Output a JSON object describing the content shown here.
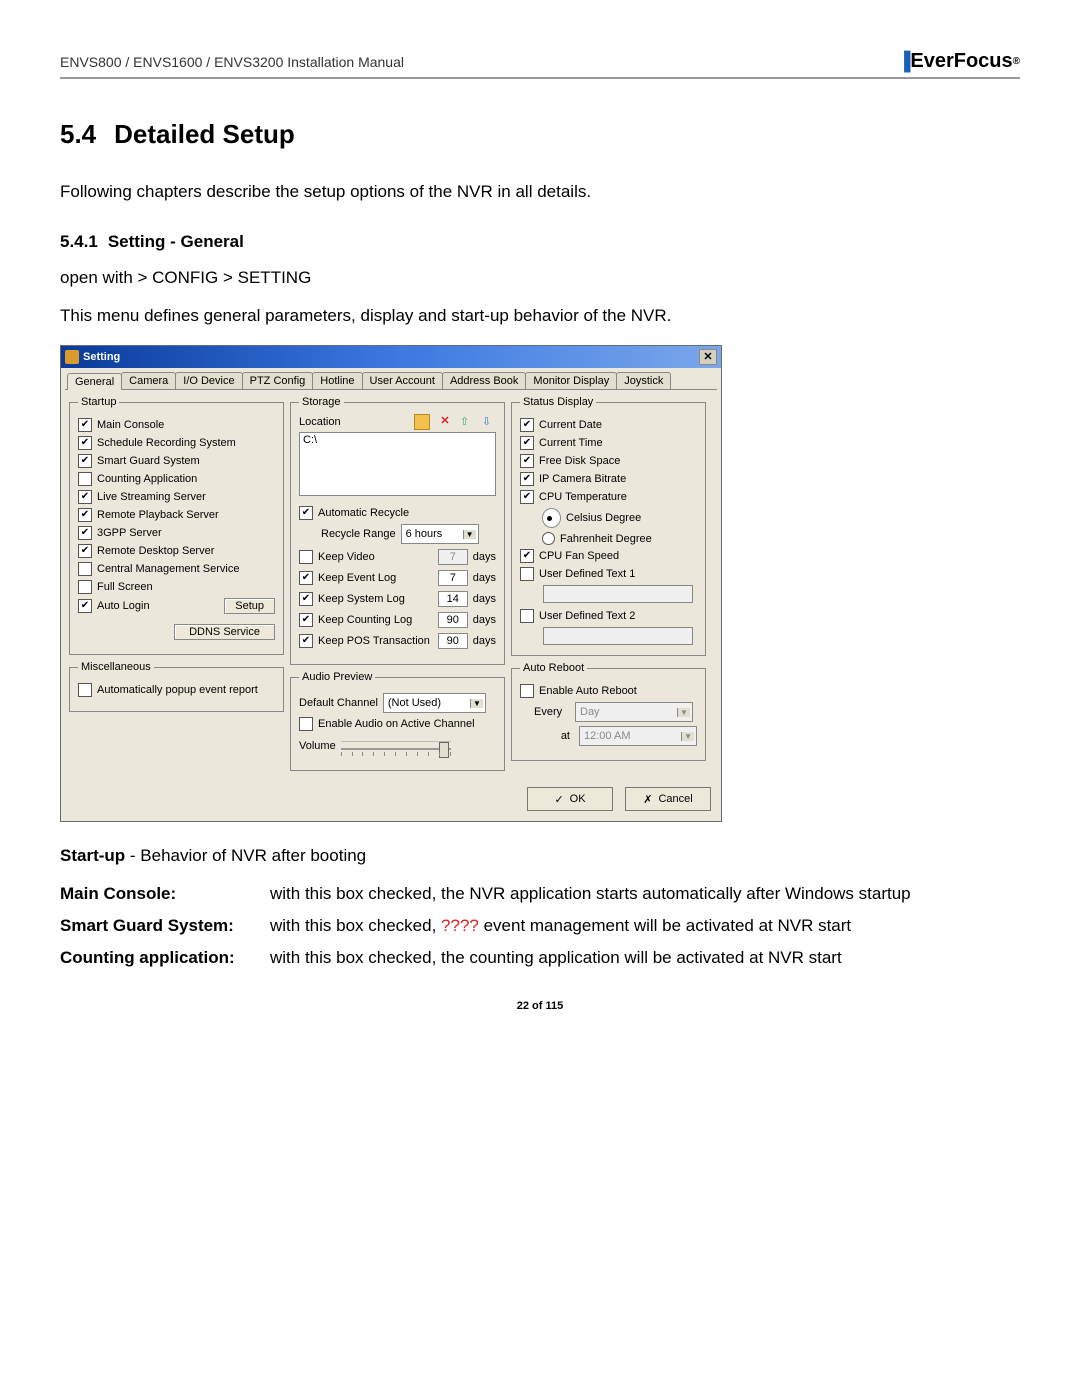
{
  "header": {
    "left": "ENVS800 / ENVS1600 / ENVS3200 Installation Manual",
    "brand": "EverFocus"
  },
  "sec": {
    "num": "5.4",
    "title": "Detailed Setup",
    "intro": "Following chapters describe the setup options of the NVR in all details."
  },
  "sub": {
    "num": "5.4.1",
    "title": "Setting - General",
    "open": "open with > CONFIG > SETTING",
    "desc": "This menu defines general parameters, display and start-up behavior of the NVR."
  },
  "dlg": {
    "title": "Setting",
    "tabs": [
      "General",
      "Camera",
      "I/O Device",
      "PTZ Config",
      "Hotline",
      "User Account",
      "Address Book",
      "Monitor Display",
      "Joystick"
    ],
    "startup": {
      "legend": "Startup",
      "items": [
        {
          "label": "Main Console",
          "chk": true
        },
        {
          "label": "Schedule Recording System",
          "chk": true
        },
        {
          "label": "Smart Guard System",
          "chk": true
        },
        {
          "label": "Counting Application",
          "chk": false
        },
        {
          "label": "Live Streaming Server",
          "chk": true
        },
        {
          "label": "Remote Playback Server",
          "chk": true
        },
        {
          "label": "3GPP Server",
          "chk": true
        },
        {
          "label": "Remote Desktop Server",
          "chk": true
        },
        {
          "label": "Central Management Service",
          "chk": false
        },
        {
          "label": "Full Screen",
          "chk": false
        },
        {
          "label": "Auto Login",
          "chk": true
        }
      ],
      "setup_btn": "Setup",
      "ddns_btn": "DDNS Service"
    },
    "misc": {
      "legend": "Miscellaneous",
      "item": {
        "label": "Automatically popup event report",
        "chk": false
      }
    },
    "storage": {
      "legend": "Storage",
      "loc_label": "Location",
      "loc_value": "C:\\",
      "auto": {
        "label": "Automatic Recycle",
        "chk": true
      },
      "recycle_label": "Recycle Range",
      "recycle_val": "6 hours",
      "keep": [
        {
          "label": "Keep Video",
          "chk": false,
          "val": "7",
          "unit": "days",
          "dis": true
        },
        {
          "label": "Keep Event Log",
          "chk": true,
          "val": "7",
          "unit": "days"
        },
        {
          "label": "Keep System Log",
          "chk": true,
          "val": "14",
          "unit": "days"
        },
        {
          "label": "Keep Counting Log",
          "chk": true,
          "val": "90",
          "unit": "days"
        },
        {
          "label": "Keep POS Transaction",
          "chk": true,
          "val": "90",
          "unit": "days"
        }
      ]
    },
    "audio": {
      "legend": "Audio Preview",
      "def_label": "Default Channel",
      "def_val": "(Not Used)",
      "enable": {
        "label": "Enable Audio on Active Channel",
        "chk": false
      },
      "vol_label": "Volume"
    },
    "status": {
      "legend": "Status Display",
      "items": [
        {
          "label": "Current Date",
          "chk": true
        },
        {
          "label": "Current Time",
          "chk": true
        },
        {
          "label": "Free Disk Space",
          "chk": true
        },
        {
          "label": "IP Camera Bitrate",
          "chk": true
        },
        {
          "label": "CPU Temperature",
          "chk": true
        }
      ],
      "temp_c": "Celsius Degree",
      "temp_f": "Fahrenheit Degree",
      "fan": {
        "label": "CPU Fan Speed",
        "chk": true
      },
      "ud1": {
        "label": "User Defined Text 1",
        "chk": false
      },
      "ud2": {
        "label": "User Defined Text 2",
        "chk": false
      }
    },
    "reboot": {
      "legend": "Auto Reboot",
      "enable": {
        "label": "Enable Auto Reboot",
        "chk": false
      },
      "every_label": "Every",
      "every_val": "Day",
      "at_label": "at",
      "at_val": "12:00 AM"
    },
    "ok": "OK",
    "cancel": "Cancel"
  },
  "notes": {
    "startup_line_b": "Start-up",
    "startup_line_r": " - Behavior of NVR after booting",
    "r1k": "Main Console:",
    "r1v": "with this box checked,  the NVR application starts automatically after Windows startup",
    "r2k": "Smart Guard System:",
    "r2v_a": "with this box checked, ",
    "r2v_q": "????",
    "r2v_b": " event management will be activated at NVR start",
    "r3k": "Counting application:",
    "r3v": "with this box checked, the counting application will be activated at NVR start"
  },
  "pgnum": "22 of 115"
}
